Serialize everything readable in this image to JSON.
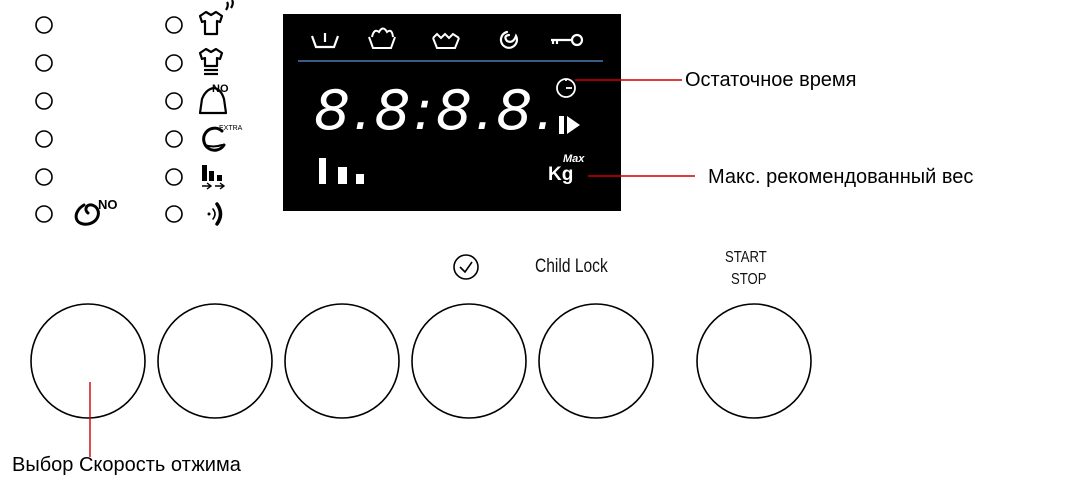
{
  "display": {
    "digits": "8.8:8.8.",
    "kg_main": "Kg",
    "kg_sup": "Max"
  },
  "badges": {
    "no_spin": "NO",
    "no_iron": "NO",
    "extra": "EXTRA"
  },
  "buttons": {
    "child_lock": "Child Lock",
    "start": "START",
    "stop": "STOP"
  },
  "annotations": {
    "remaining_time": "Остаточное время",
    "max_weight": "Макс. рекомендованный вес",
    "spin_speed": "Выбор Скорость отжима"
  },
  "colors": {
    "annotation_line": "#cc0000",
    "display_bg": "#000000",
    "display_divider": "#4a7ab0"
  }
}
